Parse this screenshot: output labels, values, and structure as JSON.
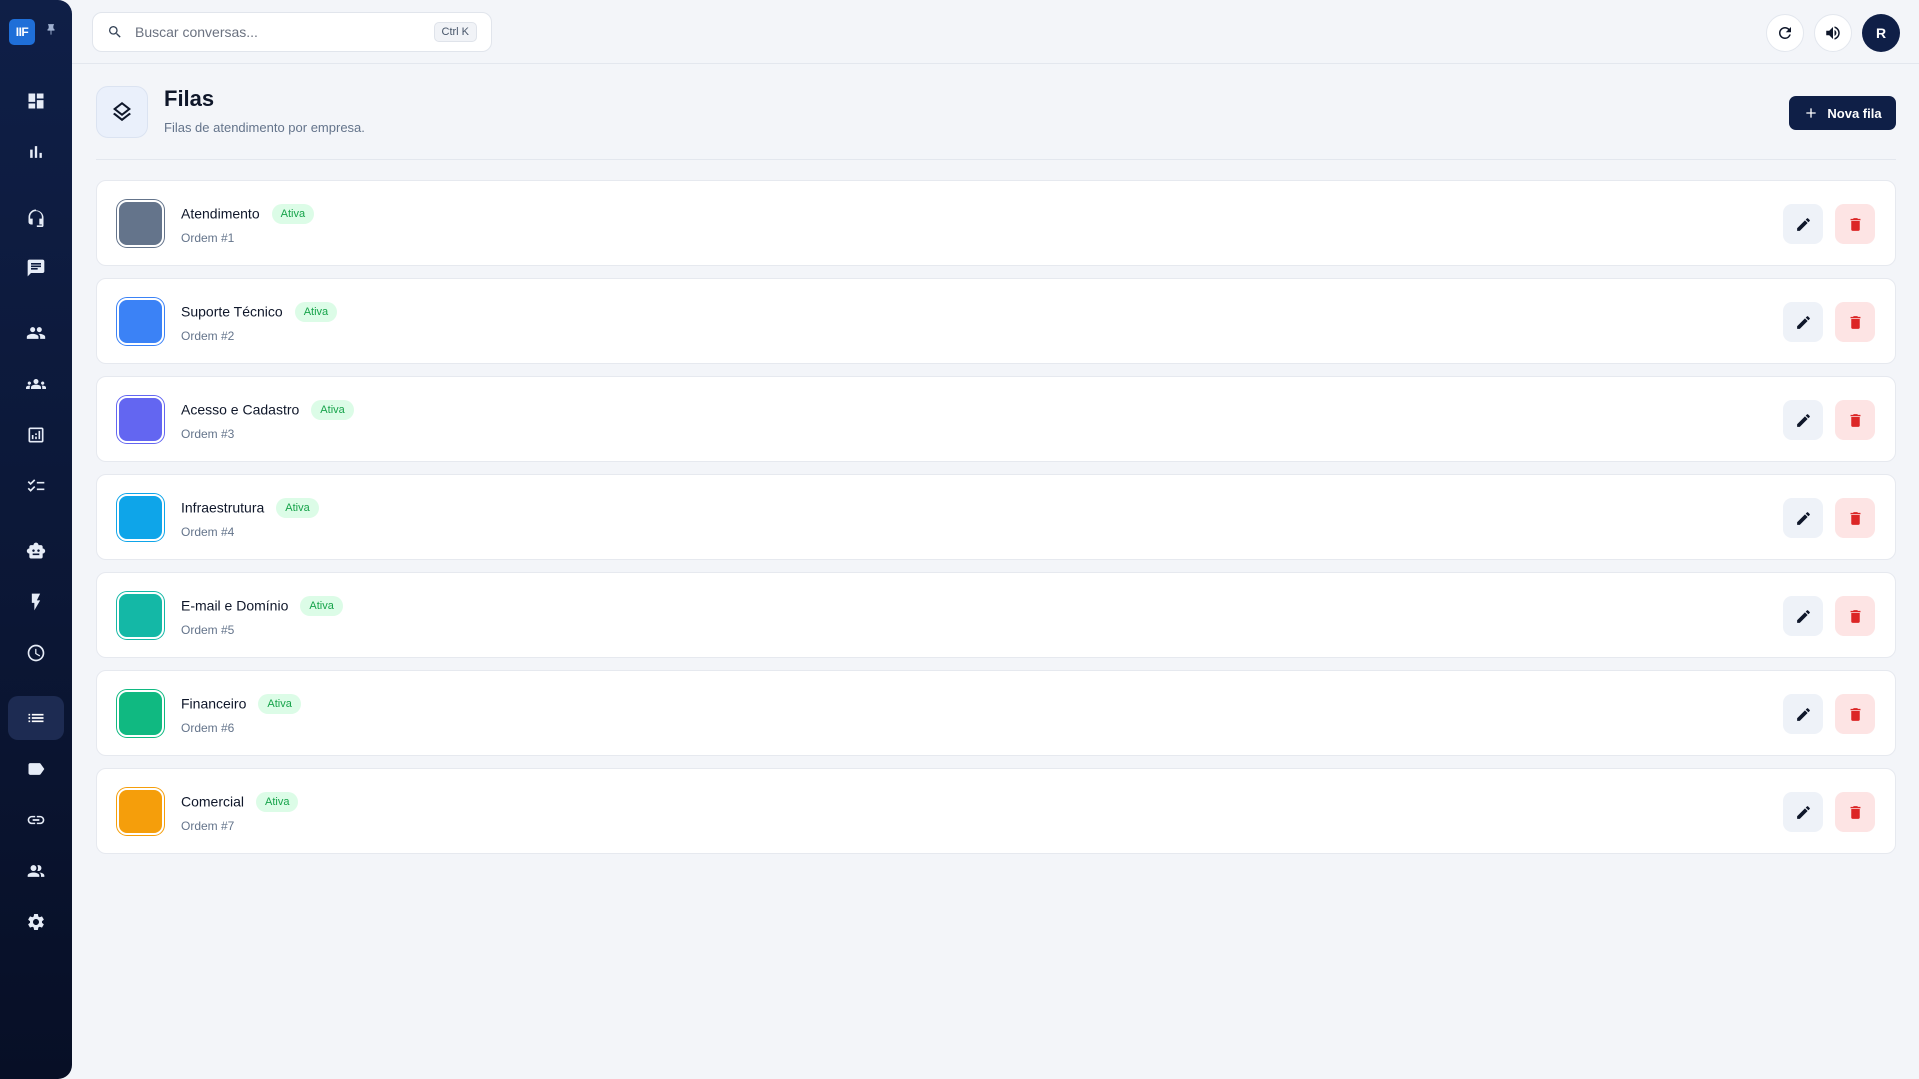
{
  "sidebar": {
    "logo_text": "IIF",
    "items": [
      {
        "icon": "dashboard-icon",
        "active": false
      },
      {
        "icon": "bar-chart-icon",
        "active": false
      },
      {
        "icon": "headset-icon",
        "active": false
      },
      {
        "icon": "chat-icon",
        "active": false
      },
      {
        "icon": "people-icon",
        "active": false
      },
      {
        "icon": "groups-icon",
        "active": false
      },
      {
        "icon": "analytics-icon",
        "active": false
      },
      {
        "icon": "checklist-icon",
        "active": false
      },
      {
        "icon": "robot-icon",
        "active": false
      },
      {
        "icon": "lightning-icon",
        "active": false
      },
      {
        "icon": "clock-icon",
        "active": false
      },
      {
        "icon": "list-icon",
        "active": true
      },
      {
        "icon": "tag-icon",
        "active": false
      },
      {
        "icon": "link-icon",
        "active": false
      },
      {
        "icon": "contacts-icon",
        "active": false
      },
      {
        "icon": "settings-icon",
        "active": false
      }
    ]
  },
  "search": {
    "placeholder": "Buscar conversas...",
    "shortcut": "Ctrl K"
  },
  "user": {
    "initial": "R"
  },
  "header": {
    "title": "Filas",
    "subtitle": "Filas de atendimento por empresa.",
    "new_button_label": "Nova fila"
  },
  "colors": {
    "primary": "#0f1f47",
    "active_badge_text": "#16a34a",
    "active_badge_bg": "#dcfce7",
    "delete": "#dc2626"
  },
  "queues": [
    {
      "name": "Atendimento",
      "status": "Ativa",
      "order": "Ordem #1",
      "color": "#64748b"
    },
    {
      "name": "Suporte Técnico",
      "status": "Ativa",
      "order": "Ordem #2",
      "color": "#3b82f6"
    },
    {
      "name": "Acesso e Cadastro",
      "status": "Ativa",
      "order": "Ordem #3",
      "color": "#6366f1"
    },
    {
      "name": "Infraestrutura",
      "status": "Ativa",
      "order": "Ordem #4",
      "color": "#0ea5e9"
    },
    {
      "name": "E-mail e Domínio",
      "status": "Ativa",
      "order": "Ordem #5",
      "color": "#14b8a6"
    },
    {
      "name": "Financeiro",
      "status": "Ativa",
      "order": "Ordem #6",
      "color": "#10b981"
    },
    {
      "name": "Comercial",
      "status": "Ativa",
      "order": "Ordem #7",
      "color": "#f59e0b"
    }
  ]
}
